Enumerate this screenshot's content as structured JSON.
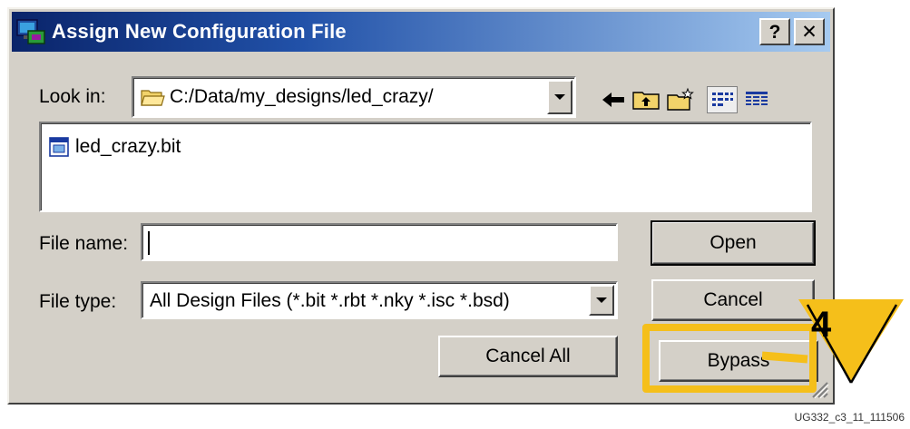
{
  "window": {
    "title": "Assign New Configuration File",
    "help_label": "?",
    "close_label": "✕"
  },
  "look_in": {
    "label": "Look in:",
    "value": "C:/Data/my_designs/led_crazy/"
  },
  "toolbar": {
    "icons": [
      "back-arrow-icon",
      "up-folder-icon",
      "new-folder-icon",
      "list-view-icon",
      "details-view-icon"
    ]
  },
  "files": [
    {
      "name": "led_crazy.bit",
      "icon": "bitstream-file-icon"
    }
  ],
  "file_name": {
    "label": "File name:",
    "value": "",
    "placeholder": ""
  },
  "file_type": {
    "label": "File type:",
    "value": "All Design Files (*.bit *.rbt *.nky *.isc *.bsd)"
  },
  "buttons": {
    "open": "Open",
    "cancel": "Cancel",
    "cancel_all": "Cancel All",
    "bypass": "Bypass"
  },
  "callout": {
    "number": "4",
    "color": "#f5bf1a"
  },
  "caption": "UG332_c3_11_111506",
  "colors": {
    "title_start": "#0a246a",
    "title_end": "#a6caf0",
    "face": "#d4d0c8",
    "highlight": "#f5bf1a"
  }
}
